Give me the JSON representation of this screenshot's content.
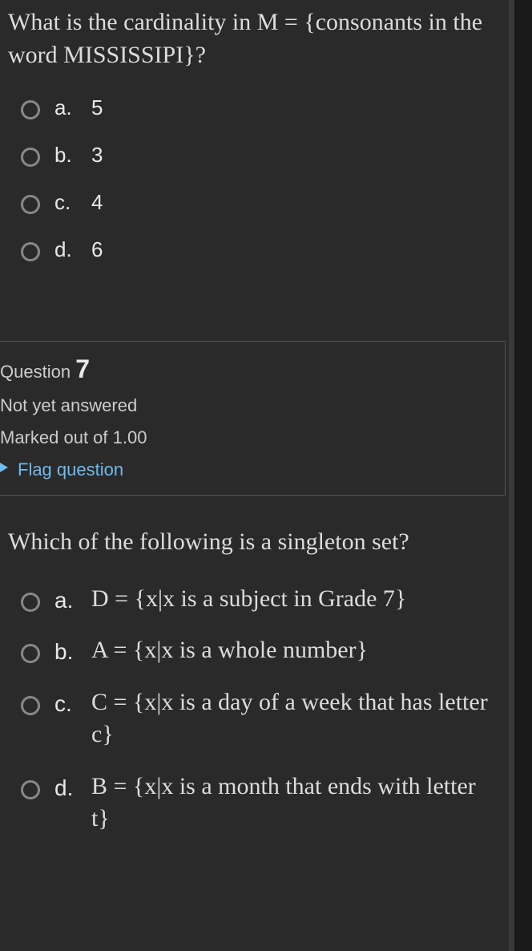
{
  "q6": {
    "prompt": "What is the cardinality in M = {consonants in the word MISSISSIPI}?",
    "options": [
      {
        "letter": "a.",
        "text": "5"
      },
      {
        "letter": "b.",
        "text": "3"
      },
      {
        "letter": "c.",
        "text": "4"
      },
      {
        "letter": "d.",
        "text": "6"
      }
    ]
  },
  "info7": {
    "question_label": "Question",
    "question_number": "7",
    "status": "Not yet answered",
    "marked_label": "Marked out of",
    "marked_value": "1.00",
    "flag_label": "Flag question"
  },
  "q7": {
    "prompt": "Which of the following is a singleton set?",
    "options": [
      {
        "letter": "a.",
        "text": "D = {x|x is a subject in Grade 7}"
      },
      {
        "letter": "b.",
        "text": "A = {x|x is a whole number}"
      },
      {
        "letter": "c.",
        "text": "C = {x|x is a day of a week that has letter c}"
      },
      {
        "letter": "d.",
        "text": "B = {x|x is a month that ends with letter t}"
      }
    ]
  }
}
